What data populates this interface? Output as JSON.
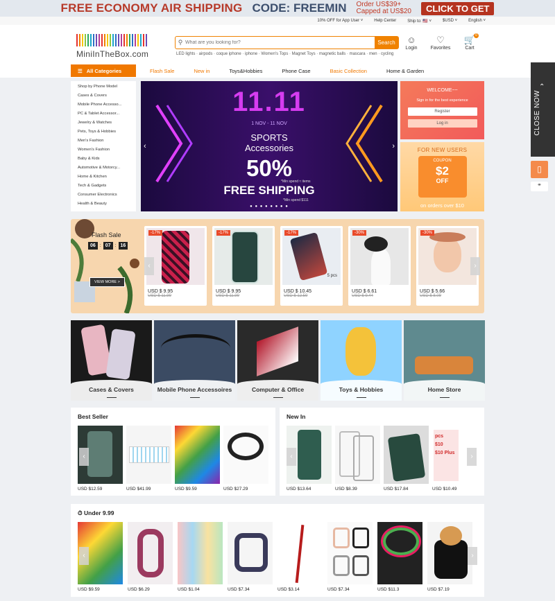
{
  "promo": {
    "headline": "FREE ECONOMY AIR SHIPPING",
    "code": "CODE: FREEMIN",
    "order": "Order US$39+",
    "capped": "Capped at US$20",
    "cta": "CLICK TO GET"
  },
  "utility": {
    "app_offer": "10% OFF for App User ˅",
    "help": "Help Center",
    "ship_label": "Ship to: 🇺🇸 ˅",
    "currency": "$USD ˅",
    "language": "English ˅"
  },
  "logo": {
    "text": "MiniInTheBox.com"
  },
  "search": {
    "placeholder": "What are you looking for?",
    "button": "Search",
    "hot": "LED lights · airpods · coque iphone · iphone · Women's Tops · Magnet Toys · magnetic balls · mascara · men · cycling"
  },
  "account": {
    "login": "Login",
    "favorites": "Favorites",
    "cart": "Cart",
    "cart_count": "0"
  },
  "nav": {
    "all_categories": "All Categories",
    "links": [
      "Flash Sale",
      "New in",
      "Toys&Hobbies",
      "Phone Case",
      "Basic Collection",
      "Home & Garden"
    ]
  },
  "categories": [
    "Shop by Phone Model",
    "Cases & Covers",
    "Mobile Phone Accesso...",
    "PC & Tablet Accessor...",
    "Jewelry & Watches",
    "Pets, Toys & Hobbies",
    "Men's Fashion",
    "Women's Fashion",
    "Baby & Kids",
    "Automotive & Motorcy...",
    "Home & Kitchen",
    "Tech & Gadgets",
    "Consumer Electronics",
    "Health & Beauty"
  ],
  "banner": {
    "title": "11.11",
    "dates": "1 NOV - 11 NOV",
    "line1": "SPORTS",
    "line2": "Accessories",
    "pct": "50%",
    "min1": "*Min spend ≈ items",
    "free": "FREE SHIPPING",
    "min2": "*Min spend $111"
  },
  "welcome": {
    "title": "WELCOME~~",
    "subtitle": "Sign in for the best experience",
    "register": "Register",
    "login": "Log in"
  },
  "coupon": {
    "title": "FOR NEW USERS",
    "label": "COUPON",
    "value": "$2",
    "off": "OFF",
    "note": "on orders over $10"
  },
  "flash": {
    "title": "Flash Sale",
    "hh": "06",
    "mm": "07",
    "ss": "16",
    "view_more": "VIEW MORE >",
    "items": [
      {
        "off": "-17%",
        "price": "USD $ 9.95",
        "old": "USD $ 11.99"
      },
      {
        "off": "-17%",
        "price": "USD $ 9.95",
        "old": "USD $ 11.99"
      },
      {
        "off": "-17%",
        "price": "USD $ 10.45",
        "old": "USD $ 12.59",
        "note": "5 pcs"
      },
      {
        "off": "-30%",
        "price": "USD $ 6.61",
        "old": "USD $ 9.44"
      },
      {
        "off": "-30%",
        "price": "USD $ 5.66",
        "old": "USD $ 8.09"
      }
    ]
  },
  "tiles": [
    "Cases & Covers",
    "Mobile Phone Accessoires",
    "Computer & Office",
    "Toys & Hobbies",
    "Home Store"
  ],
  "best_seller": {
    "title": "Best Seller",
    "prices": [
      "USD $12.59",
      "USD $41.99",
      "USD $9.59",
      "USD $27.29"
    ]
  },
  "new_in": {
    "title": "New In",
    "prices": [
      "USD $13.64",
      "USD $8.39",
      "USD $17.84",
      "USD $10.49"
    ]
  },
  "under": {
    "title": "Under 9.99",
    "prices": [
      "USD $9.59",
      "USD $6.29",
      "USD $1.04",
      "USD $7.34",
      "USD $3.14",
      "USD $7.34",
      "USD $11.3",
      "USD $7.19"
    ]
  },
  "sidebar": {
    "close": "CLOSE NOW"
  }
}
